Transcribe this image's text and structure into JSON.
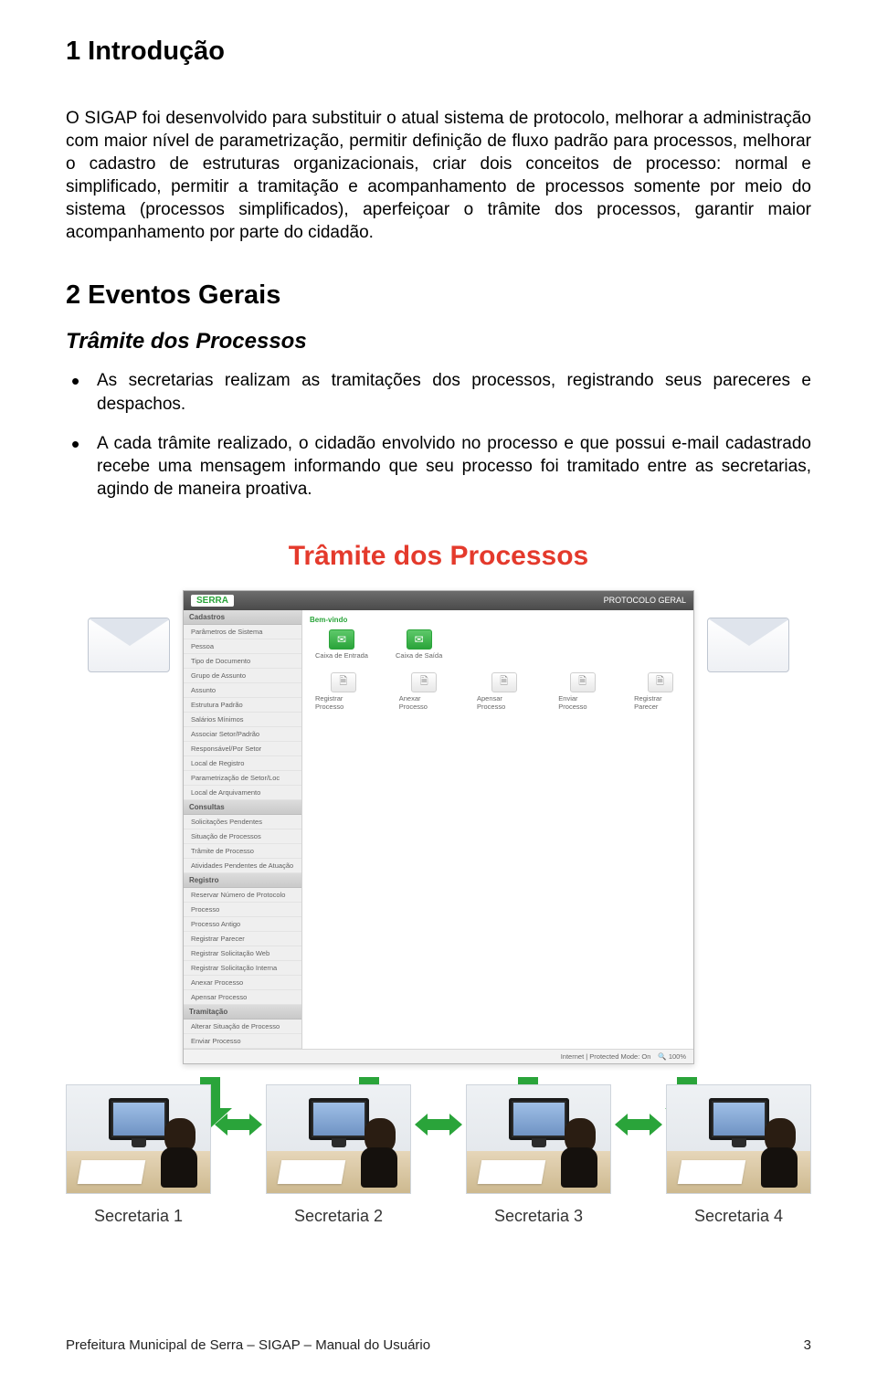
{
  "sections": {
    "intro": {
      "title": "1  Introdução",
      "paragraph": "O SIGAP foi desenvolvido para substituir o atual sistema de protocolo, melhorar a administração com maior nível de parametrização, permitir definição de fluxo padrão para processos, melhorar o cadastro de estruturas organizacionais, criar dois conceitos de processo: normal e simplificado, permitir a tramitação e acompanhamento de processos somente por meio do sistema (processos simplificados), aperfeiçoar o trâmite dos processos, garantir maior acompanhamento por parte do cidadão."
    },
    "eventos": {
      "title": "2  Eventos Gerais",
      "subtitle": "Trâmite dos Processos",
      "bullets": [
        "As secretarias realizam as tramitações dos processos, registrando seus pareceres e despachos.",
        "A cada trâmite realizado, o cidadão envolvido no processo e que possui e-mail cadastrado recebe uma mensagem informando que seu processo foi tramitado entre as secretarias, agindo de maneira proativa."
      ]
    }
  },
  "diagram": {
    "title": "Trâmite dos Processos",
    "app": {
      "logo": "SERRA",
      "header_right": "PROTOCOLO GERAL",
      "breadcrumb": "Bem-vindo",
      "sidebar": {
        "groups": [
          {
            "label": "Cadastros",
            "items": [
              "Parâmetros de Sistema",
              "Pessoa",
              "Tipo de Documento",
              "Grupo de Assunto",
              "Assunto",
              "Estrutura Padrão",
              "Salários Mínimos",
              "Associar Setor/Padrão",
              "Responsável/Por Setor",
              "Local de Registro",
              "Parametrização de Setor/Loc",
              "Local de Arquivamento"
            ]
          },
          {
            "label": "Consultas",
            "items": [
              "Solicitações Pendentes",
              "Situação de Processos",
              "Trâmite de Processo",
              "Atividades Pendentes de Atuação"
            ]
          },
          {
            "label": "Registro",
            "items": [
              "Reservar Número de Protocolo",
              "Processo",
              "Processo Antigo",
              "Registrar Parecer",
              "Registrar Solicitação Web",
              "Registrar Solicitação Interna",
              "Anexar Processo",
              "Apensar Processo"
            ]
          },
          {
            "label": "Tramitação",
            "items": [
              "Alterar Situação de Processo",
              "Enviar Processo"
            ]
          }
        ]
      },
      "tiles_top": [
        "Caixa de Entrada",
        "Caixa de Saída"
      ],
      "tiles_bottom": [
        "Registrar Processo",
        "Anexar Processo",
        "Apensar Processo",
        "Enviar Processo",
        "Registrar Parecer"
      ],
      "status": {
        "mode": "Internet | Protected Mode: On",
        "zoom": "🔍 100%"
      }
    },
    "stations": [
      "Secretaria 1",
      "Secretaria 2",
      "Secretaria 3",
      "Secretaria 4"
    ]
  },
  "footer": {
    "left": "Prefeitura Municipal de Serra – SIGAP – Manual do Usuário",
    "right": "3"
  }
}
